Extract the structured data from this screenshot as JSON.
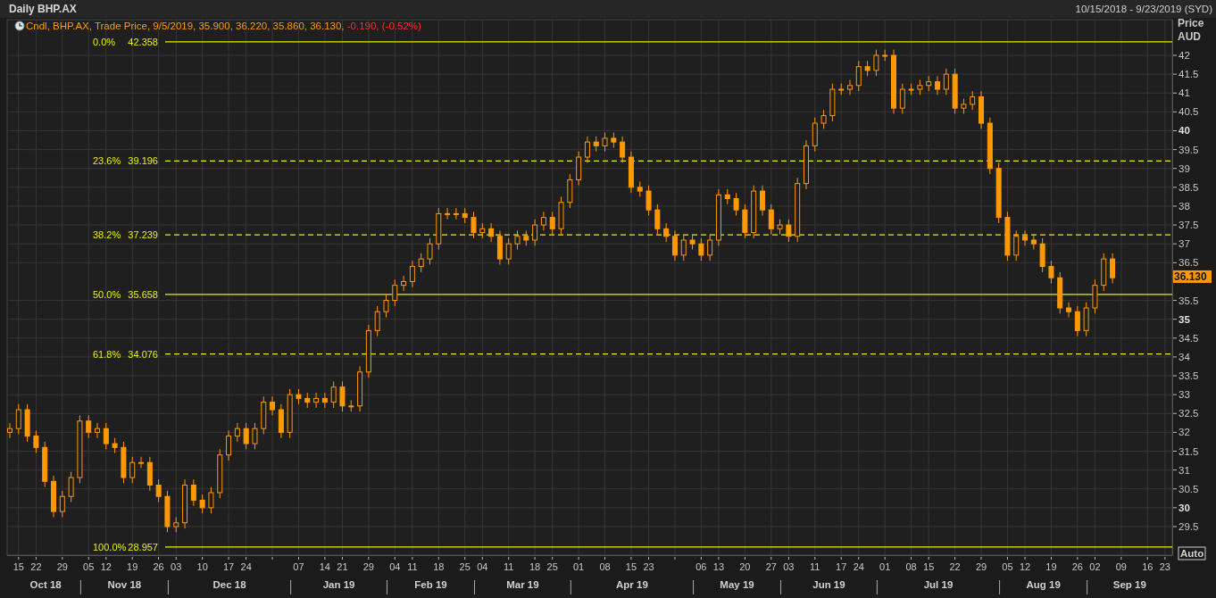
{
  "header": {
    "title": "Daily BHP.AX",
    "date_range": "10/15/2018 - 9/23/2019 (SYD)"
  },
  "chart": {
    "legend": {
      "text": "Cndl, BHP.AX, Trade Price, 9/5/2019, 35.900, 36.220, 35.860, 36.130, ",
      "change": "-0.190, (-0.52%)"
    },
    "fib_levels": [
      {
        "percent": "0.0%",
        "kind": "solid"
      },
      {
        "percent": "23.6%",
        "kind": "dashed"
      },
      {
        "percent": "38.2%",
        "kind": "dashed"
      },
      {
        "percent": "50.0%",
        "kind": "solid"
      },
      {
        "percent": "61.8%",
        "kind": "dashed"
      },
      {
        "percent": "100.0%",
        "kind": "solid"
      }
    ],
    "y_axis": {
      "title": "Price",
      "unit": "AUD",
      "last_price": "36.130",
      "scale_button": "Auto"
    },
    "x_axis": {
      "months": [
        {
          "label": "Oct 18"
        },
        {
          "label": "Nov 18"
        },
        {
          "label": "Dec 18"
        },
        {
          "label": "Jan 19"
        },
        {
          "label": "Feb 19"
        },
        {
          "label": "Mar 19"
        },
        {
          "label": "Apr 19"
        },
        {
          "label": "May 19"
        },
        {
          "label": "Jun 19"
        },
        {
          "label": "Jul 19"
        },
        {
          "label": "Aug 19"
        },
        {
          "label": "Sep 19"
        }
      ]
    },
    "chart_data": {
      "type": "candlestick",
      "grid": true,
      "ylim": [
        28.742,
        42.947
      ],
      "categories": [
        null,
        "15",
        null,
        "22",
        null,
        null,
        "29",
        null,
        null,
        "05",
        null,
        "12",
        null,
        null,
        "19",
        null,
        null,
        "26",
        null,
        "03",
        null,
        null,
        "10",
        null,
        null,
        "17",
        null,
        "24",
        null,
        null,
        null,
        null,
        null,
        "07",
        null,
        null,
        "14",
        null,
        "21",
        null,
        null,
        "29",
        null,
        null,
        "04",
        null,
        "11",
        null,
        null,
        "18",
        null,
        null,
        "25",
        null,
        "04",
        null,
        null,
        "11",
        null,
        null,
        "18",
        null,
        "25",
        null,
        null,
        "01",
        null,
        null,
        "08",
        null,
        null,
        "15",
        null,
        "23",
        null,
        null,
        null,
        null,
        null,
        "06",
        null,
        "13",
        null,
        null,
        "20",
        null,
        null,
        "27",
        null,
        "03",
        null,
        null,
        "11",
        null,
        null,
        "17",
        null,
        "24",
        null,
        null,
        "01",
        null,
        null,
        "08",
        null,
        "15",
        null,
        null,
        "22",
        null,
        null,
        "29",
        null,
        null,
        "05",
        null,
        "12",
        null,
        null,
        "19",
        null,
        null,
        "26",
        null,
        "02",
        null,
        null,
        "09",
        null,
        null,
        "16",
        null,
        "23"
      ],
      "yticks": [
        29.5,
        30,
        30.5,
        31,
        31.5,
        32,
        32.5,
        33,
        33.5,
        34,
        34.5,
        35,
        35.5,
        36.5,
        37,
        37.5,
        38,
        38.5,
        39,
        39.5,
        40,
        40.5,
        41,
        41.5,
        42
      ],
      "ref_lines": [
        {
          "axis": "y",
          "value": 42.358,
          "label": "42.358"
        },
        {
          "axis": "y",
          "value": 39.196,
          "label": "39.196"
        },
        {
          "axis": "y",
          "value": 37.239,
          "label": "37.239"
        },
        {
          "axis": "y",
          "value": 35.658,
          "label": "35.658"
        },
        {
          "axis": "y",
          "value": 34.076,
          "label": "34.076"
        },
        {
          "axis": "y",
          "value": 28.957,
          "label": "28.957"
        }
      ],
      "ohlc": [
        [
          32.0,
          32.25,
          31.85,
          32.1
        ],
        [
          32.1,
          32.75,
          31.95,
          32.6
        ],
        [
          32.6,
          32.75,
          31.75,
          31.9
        ],
        [
          31.9,
          32.05,
          31.45,
          31.6
        ],
        [
          31.6,
          31.75,
          30.55,
          30.7
        ],
        [
          30.7,
          30.85,
          29.75,
          29.9
        ],
        [
          29.9,
          30.45,
          29.75,
          30.3
        ],
        [
          30.3,
          30.95,
          30.15,
          30.8
        ],
        [
          30.8,
          32.45,
          30.65,
          32.3
        ],
        [
          32.3,
          32.45,
          31.85,
          32.0
        ],
        [
          32.0,
          32.25,
          31.85,
          32.1
        ],
        [
          32.1,
          32.25,
          31.55,
          31.7
        ],
        [
          31.7,
          31.85,
          31.45,
          31.6
        ],
        [
          31.6,
          31.75,
          30.65,
          30.8
        ],
        [
          30.8,
          31.35,
          30.65,
          31.2
        ],
        [
          31.2,
          31.35,
          31.05,
          31.2
        ],
        [
          31.2,
          31.35,
          30.45,
          30.6
        ],
        [
          30.6,
          30.75,
          30.15,
          30.3
        ],
        [
          30.3,
          30.45,
          29.35,
          29.5
        ],
        [
          29.5,
          29.75,
          29.35,
          29.6
        ],
        [
          29.6,
          30.75,
          29.45,
          30.6
        ],
        [
          30.6,
          30.75,
          30.05,
          30.2
        ],
        [
          30.2,
          30.35,
          29.85,
          30.0
        ],
        [
          30.0,
          30.55,
          29.85,
          30.4
        ],
        [
          30.4,
          31.55,
          30.25,
          31.4
        ],
        [
          31.4,
          32.05,
          31.25,
          31.9
        ],
        [
          31.9,
          32.25,
          31.75,
          32.1
        ],
        [
          32.1,
          32.25,
          31.55,
          31.7
        ],
        [
          31.7,
          32.25,
          31.55,
          32.1
        ],
        [
          32.1,
          32.95,
          31.95,
          32.8
        ],
        [
          32.8,
          32.95,
          32.45,
          32.6
        ],
        [
          32.6,
          32.75,
          31.85,
          32.0
        ],
        [
          32.0,
          33.15,
          31.85,
          33.0
        ],
        [
          33.0,
          33.15,
          32.75,
          32.9
        ],
        [
          32.9,
          33.05,
          32.65,
          32.8
        ],
        [
          32.8,
          33.05,
          32.65,
          32.9
        ],
        [
          32.9,
          33.05,
          32.65,
          32.8
        ],
        [
          32.8,
          33.35,
          32.65,
          33.2
        ],
        [
          33.2,
          33.35,
          32.55,
          32.7
        ],
        [
          32.7,
          32.85,
          32.55,
          32.7
        ],
        [
          32.7,
          33.75,
          32.55,
          33.6
        ],
        [
          33.6,
          34.85,
          33.45,
          34.7
        ],
        [
          34.7,
          35.35,
          34.55,
          35.2
        ],
        [
          35.2,
          35.65,
          35.05,
          35.5
        ],
        [
          35.5,
          36.05,
          35.35,
          35.9
        ],
        [
          35.9,
          36.15,
          35.75,
          36.0
        ],
        [
          36.0,
          36.55,
          35.85,
          36.4
        ],
        [
          36.4,
          36.75,
          36.25,
          36.6
        ],
        [
          36.6,
          37.15,
          36.45,
          37.0
        ],
        [
          37.0,
          37.95,
          36.85,
          37.8
        ],
        [
          37.8,
          37.95,
          37.65,
          37.8
        ],
        [
          37.8,
          37.95,
          37.65,
          37.8
        ],
        [
          37.8,
          37.95,
          37.55,
          37.7
        ],
        [
          37.7,
          37.85,
          37.15,
          37.3
        ],
        [
          37.3,
          37.55,
          37.15,
          37.4
        ],
        [
          37.4,
          37.55,
          37.05,
          37.2
        ],
        [
          37.2,
          37.35,
          36.45,
          36.6
        ],
        [
          36.6,
          37.15,
          36.45,
          37.0
        ],
        [
          37.0,
          37.35,
          36.85,
          37.2
        ],
        [
          37.2,
          37.35,
          36.95,
          37.1
        ],
        [
          37.1,
          37.65,
          36.95,
          37.5
        ],
        [
          37.5,
          37.85,
          37.35,
          37.7
        ],
        [
          37.7,
          37.85,
          37.25,
          37.4
        ],
        [
          37.4,
          38.25,
          37.25,
          38.1
        ],
        [
          38.1,
          38.85,
          37.95,
          38.7
        ],
        [
          38.7,
          39.45,
          38.55,
          39.3
        ],
        [
          39.3,
          39.85,
          39.15,
          39.7
        ],
        [
          39.7,
          39.85,
          39.45,
          39.6
        ],
        [
          39.6,
          39.95,
          39.45,
          39.8
        ],
        [
          39.8,
          39.95,
          39.55,
          39.7
        ],
        [
          39.7,
          39.85,
          39.15,
          39.3
        ],
        [
          39.3,
          39.45,
          38.35,
          38.5
        ],
        [
          38.5,
          38.65,
          38.25,
          38.4
        ],
        [
          38.4,
          38.55,
          37.75,
          37.9
        ],
        [
          37.9,
          38.05,
          37.25,
          37.4
        ],
        [
          37.4,
          37.55,
          37.05,
          37.2
        ],
        [
          37.2,
          37.35,
          36.55,
          36.7
        ],
        [
          36.7,
          37.25,
          36.55,
          37.1
        ],
        [
          37.1,
          37.25,
          36.85,
          37.0
        ],
        [
          37.0,
          37.15,
          36.55,
          36.7
        ],
        [
          36.7,
          37.25,
          36.55,
          37.1
        ],
        [
          37.1,
          38.45,
          36.95,
          38.3
        ],
        [
          38.3,
          38.45,
          38.05,
          38.2
        ],
        [
          38.2,
          38.35,
          37.75,
          37.9
        ],
        [
          37.9,
          38.05,
          37.15,
          37.3
        ],
        [
          37.3,
          38.55,
          37.15,
          38.4
        ],
        [
          38.4,
          38.55,
          37.75,
          37.9
        ],
        [
          37.9,
          38.05,
          37.25,
          37.4
        ],
        [
          37.4,
          37.65,
          37.25,
          37.5
        ],
        [
          37.5,
          37.65,
          37.05,
          37.2
        ],
        [
          37.2,
          38.75,
          37.05,
          38.6
        ],
        [
          38.6,
          39.75,
          38.45,
          39.6
        ],
        [
          39.6,
          40.35,
          39.45,
          40.2
        ],
        [
          40.2,
          40.55,
          40.05,
          40.4
        ],
        [
          40.4,
          41.25,
          40.25,
          41.1
        ],
        [
          41.1,
          41.25,
          40.95,
          41.1
        ],
        [
          41.1,
          41.35,
          40.95,
          41.2
        ],
        [
          41.2,
          41.85,
          41.05,
          41.7
        ],
        [
          41.7,
          41.85,
          41.45,
          41.6
        ],
        [
          41.6,
          42.15,
          41.45,
          42.0
        ],
        [
          42.0,
          42.15,
          41.85,
          42.0
        ],
        [
          42.0,
          42.15,
          40.45,
          40.6
        ],
        [
          40.6,
          41.25,
          40.45,
          41.1
        ],
        [
          41.1,
          41.25,
          40.95,
          41.1
        ],
        [
          41.1,
          41.35,
          40.95,
          41.2
        ],
        [
          41.2,
          41.45,
          41.05,
          41.3
        ],
        [
          41.3,
          41.45,
          40.95,
          41.1
        ],
        [
          41.1,
          41.65,
          40.95,
          41.5
        ],
        [
          41.5,
          41.65,
          40.45,
          40.6
        ],
        [
          40.6,
          40.85,
          40.45,
          40.7
        ],
        [
          40.7,
          41.05,
          40.55,
          40.9
        ],
        [
          40.9,
          41.05,
          40.05,
          40.2
        ],
        [
          40.2,
          40.35,
          38.85,
          39.0
        ],
        [
          39.0,
          39.15,
          37.55,
          37.7
        ],
        [
          37.7,
          37.85,
          36.55,
          36.7
        ],
        [
          36.7,
          37.35,
          36.55,
          37.2
        ],
        [
          37.2,
          37.35,
          36.95,
          37.1
        ],
        [
          37.1,
          37.25,
          36.85,
          37.0
        ],
        [
          37.0,
          37.15,
          36.25,
          36.4
        ],
        [
          36.4,
          36.55,
          35.95,
          36.1
        ],
        [
          36.1,
          36.25,
          35.15,
          35.3
        ],
        [
          35.3,
          35.45,
          35.05,
          35.2
        ],
        [
          35.2,
          35.35,
          34.55,
          34.7
        ],
        [
          34.7,
          35.45,
          34.55,
          35.3
        ],
        [
          35.3,
          36.05,
          35.15,
          35.9
        ],
        [
          35.9,
          36.75,
          35.75,
          36.6
        ],
        [
          36.6,
          36.75,
          35.95,
          36.1
        ],
        null,
        null,
        null,
        null,
        null,
        null
      ]
    }
  }
}
